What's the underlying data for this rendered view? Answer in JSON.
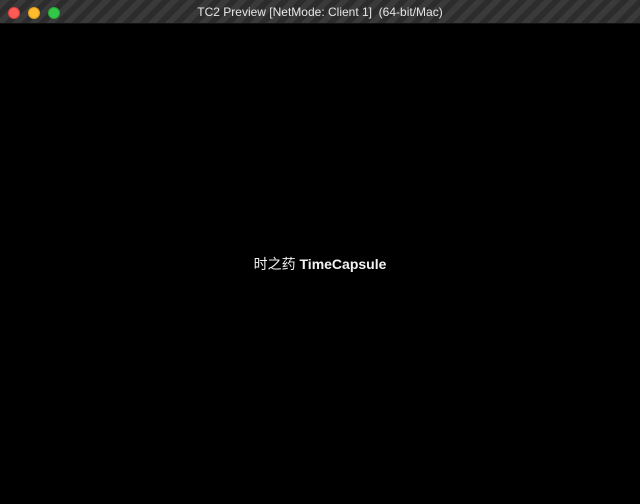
{
  "window": {
    "title": "TC2 Preview [NetMode: Client 1]  (64-bit/Mac)",
    "controls": [
      {
        "name": "close",
        "color": "#fc5b57"
      },
      {
        "name": "minimize",
        "color": "#fdbc2e"
      },
      {
        "name": "zoom",
        "color": "#33c748"
      }
    ]
  },
  "viewport": {
    "background": "#000000",
    "splash_chinese": "时之药",
    "splash_english": "TimeCapsule"
  }
}
